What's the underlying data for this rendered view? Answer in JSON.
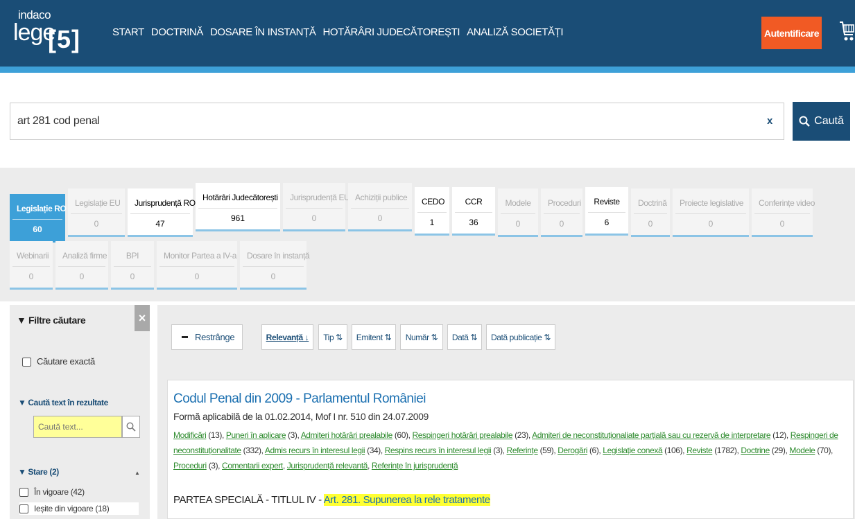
{
  "header": {
    "logo_top": "indaco",
    "logo_main": "lege",
    "logo_num": "[5]",
    "nav": [
      "START",
      "DOCTRINĂ",
      "DOSARE ÎN INSTANȚĂ",
      "HOTĂRÂRI JUDECĂTOREȘTI",
      "ANALIZĂ SOCIETĂȚI"
    ],
    "login_label": "Autentificare",
    "colors": {
      "header_bg": "#1a4d76",
      "stripe": "#3da0d8",
      "login": "#f15a24"
    }
  },
  "search": {
    "value": "art 281 cod penal",
    "clear_label": "x",
    "button_label": "Caută"
  },
  "tabs": [
    {
      "label": "Legislație RO",
      "count": "60",
      "state": "active"
    },
    {
      "label": "Legislație EU",
      "count": "0",
      "state": "disabled"
    },
    {
      "label": "Jurisprudență RO",
      "count": "47",
      "state": "normal"
    },
    {
      "label": "Hotărâri Judecătorești",
      "count": "961",
      "state": "normal"
    },
    {
      "label": "Jurisprudență EU",
      "count": "0",
      "state": "disabled"
    },
    {
      "label": "Achiziții publice",
      "count": "0",
      "state": "disabled"
    },
    {
      "label": "CEDO",
      "count": "1",
      "state": "normal"
    },
    {
      "label": "CCR",
      "count": "36",
      "state": "normal"
    },
    {
      "label": "Modele",
      "count": "0",
      "state": "disabled"
    },
    {
      "label": "Proceduri",
      "count": "0",
      "state": "disabled"
    },
    {
      "label": "Reviste",
      "count": "6",
      "state": "normal"
    },
    {
      "label": "Doctrină",
      "count": "0",
      "state": "disabled"
    },
    {
      "label": "Proiecte legislative",
      "count": "0",
      "state": "disabled"
    },
    {
      "label": "Conferințe video",
      "count": "0",
      "state": "disabled"
    },
    {
      "label": "Webinarii",
      "count": "0",
      "state": "disabled"
    },
    {
      "label": "Analiză firme",
      "count": "0",
      "state": "disabled"
    },
    {
      "label": "BPI",
      "count": "0",
      "state": "disabled"
    },
    {
      "label": "Monitor Partea a IV-a",
      "count": "0",
      "state": "disabled"
    },
    {
      "label": "Dosare în instanță",
      "count": "0",
      "state": "disabled"
    }
  ],
  "sidebar": {
    "title": "▼ Filtre căutare",
    "close_label": "×",
    "exact_label": "Căutare exactă",
    "search_in_results": "▼ Caută text în rezultate",
    "search_placeholder": "Caută text...",
    "stare_title": "▼ Stare (2)",
    "stare_items": [
      "În vigoare (42)",
      "Ieșite din vigoare (18)"
    ]
  },
  "results": {
    "collapse_label": "Restrânge",
    "sort": [
      "Relevanță ↓",
      "Tip ⇅",
      "Emitent ⇅",
      "Număr ⇅",
      "Dată ⇅",
      "Dată publicație ⇅"
    ],
    "card": {
      "title": "Codul Penal din 2009 - Parlamentul României",
      "subtitle": "Formă aplicabilă de la 01.02.2014, Mof I nr. 510 din 24.07.2009",
      "links": [
        {
          "text": "Modificări",
          "count": " (13), "
        },
        {
          "text": "Puneri în aplicare",
          "count": " (3), "
        },
        {
          "text": "Admiteri hotărâri prealabile",
          "count": " (60), "
        },
        {
          "text": "Respingeri hotărâri prealabile",
          "count": " (23), "
        },
        {
          "text": "Admiteri de neconstituționaliate parțială sau cu rezervă de interpretare",
          "count": " (12), "
        },
        {
          "text": "Respingeri de neconstituționalitate",
          "count": " (332), "
        },
        {
          "text": "Admis recurs în interesul legii",
          "count": " (34), "
        },
        {
          "text": "Respins recurs în interesul legii",
          "count": " (3), "
        },
        {
          "text": "Referințe",
          "count": " (59), "
        },
        {
          "text": "Derogări",
          "count": " (6), "
        },
        {
          "text": "Legislație conexă",
          "count": " (106), "
        },
        {
          "text": "Reviste",
          "count": " (1782), "
        },
        {
          "text": "Doctrine",
          "count": " (29), "
        },
        {
          "text": "Modele",
          "count": " (70), "
        },
        {
          "text": "Proceduri",
          "count": " (3), "
        },
        {
          "text": "Comentarii expert",
          "count": ", "
        },
        {
          "text": "Jurisprudență relevantă",
          "count": ", "
        },
        {
          "text": "Referințe în jurisprudență",
          "count": ""
        }
      ],
      "part_prefix": "PARTEA SPECIALĂ - TITLUL IV - ",
      "part_highlight": "Art. 281. Supunerea la rele tratamente"
    }
  }
}
